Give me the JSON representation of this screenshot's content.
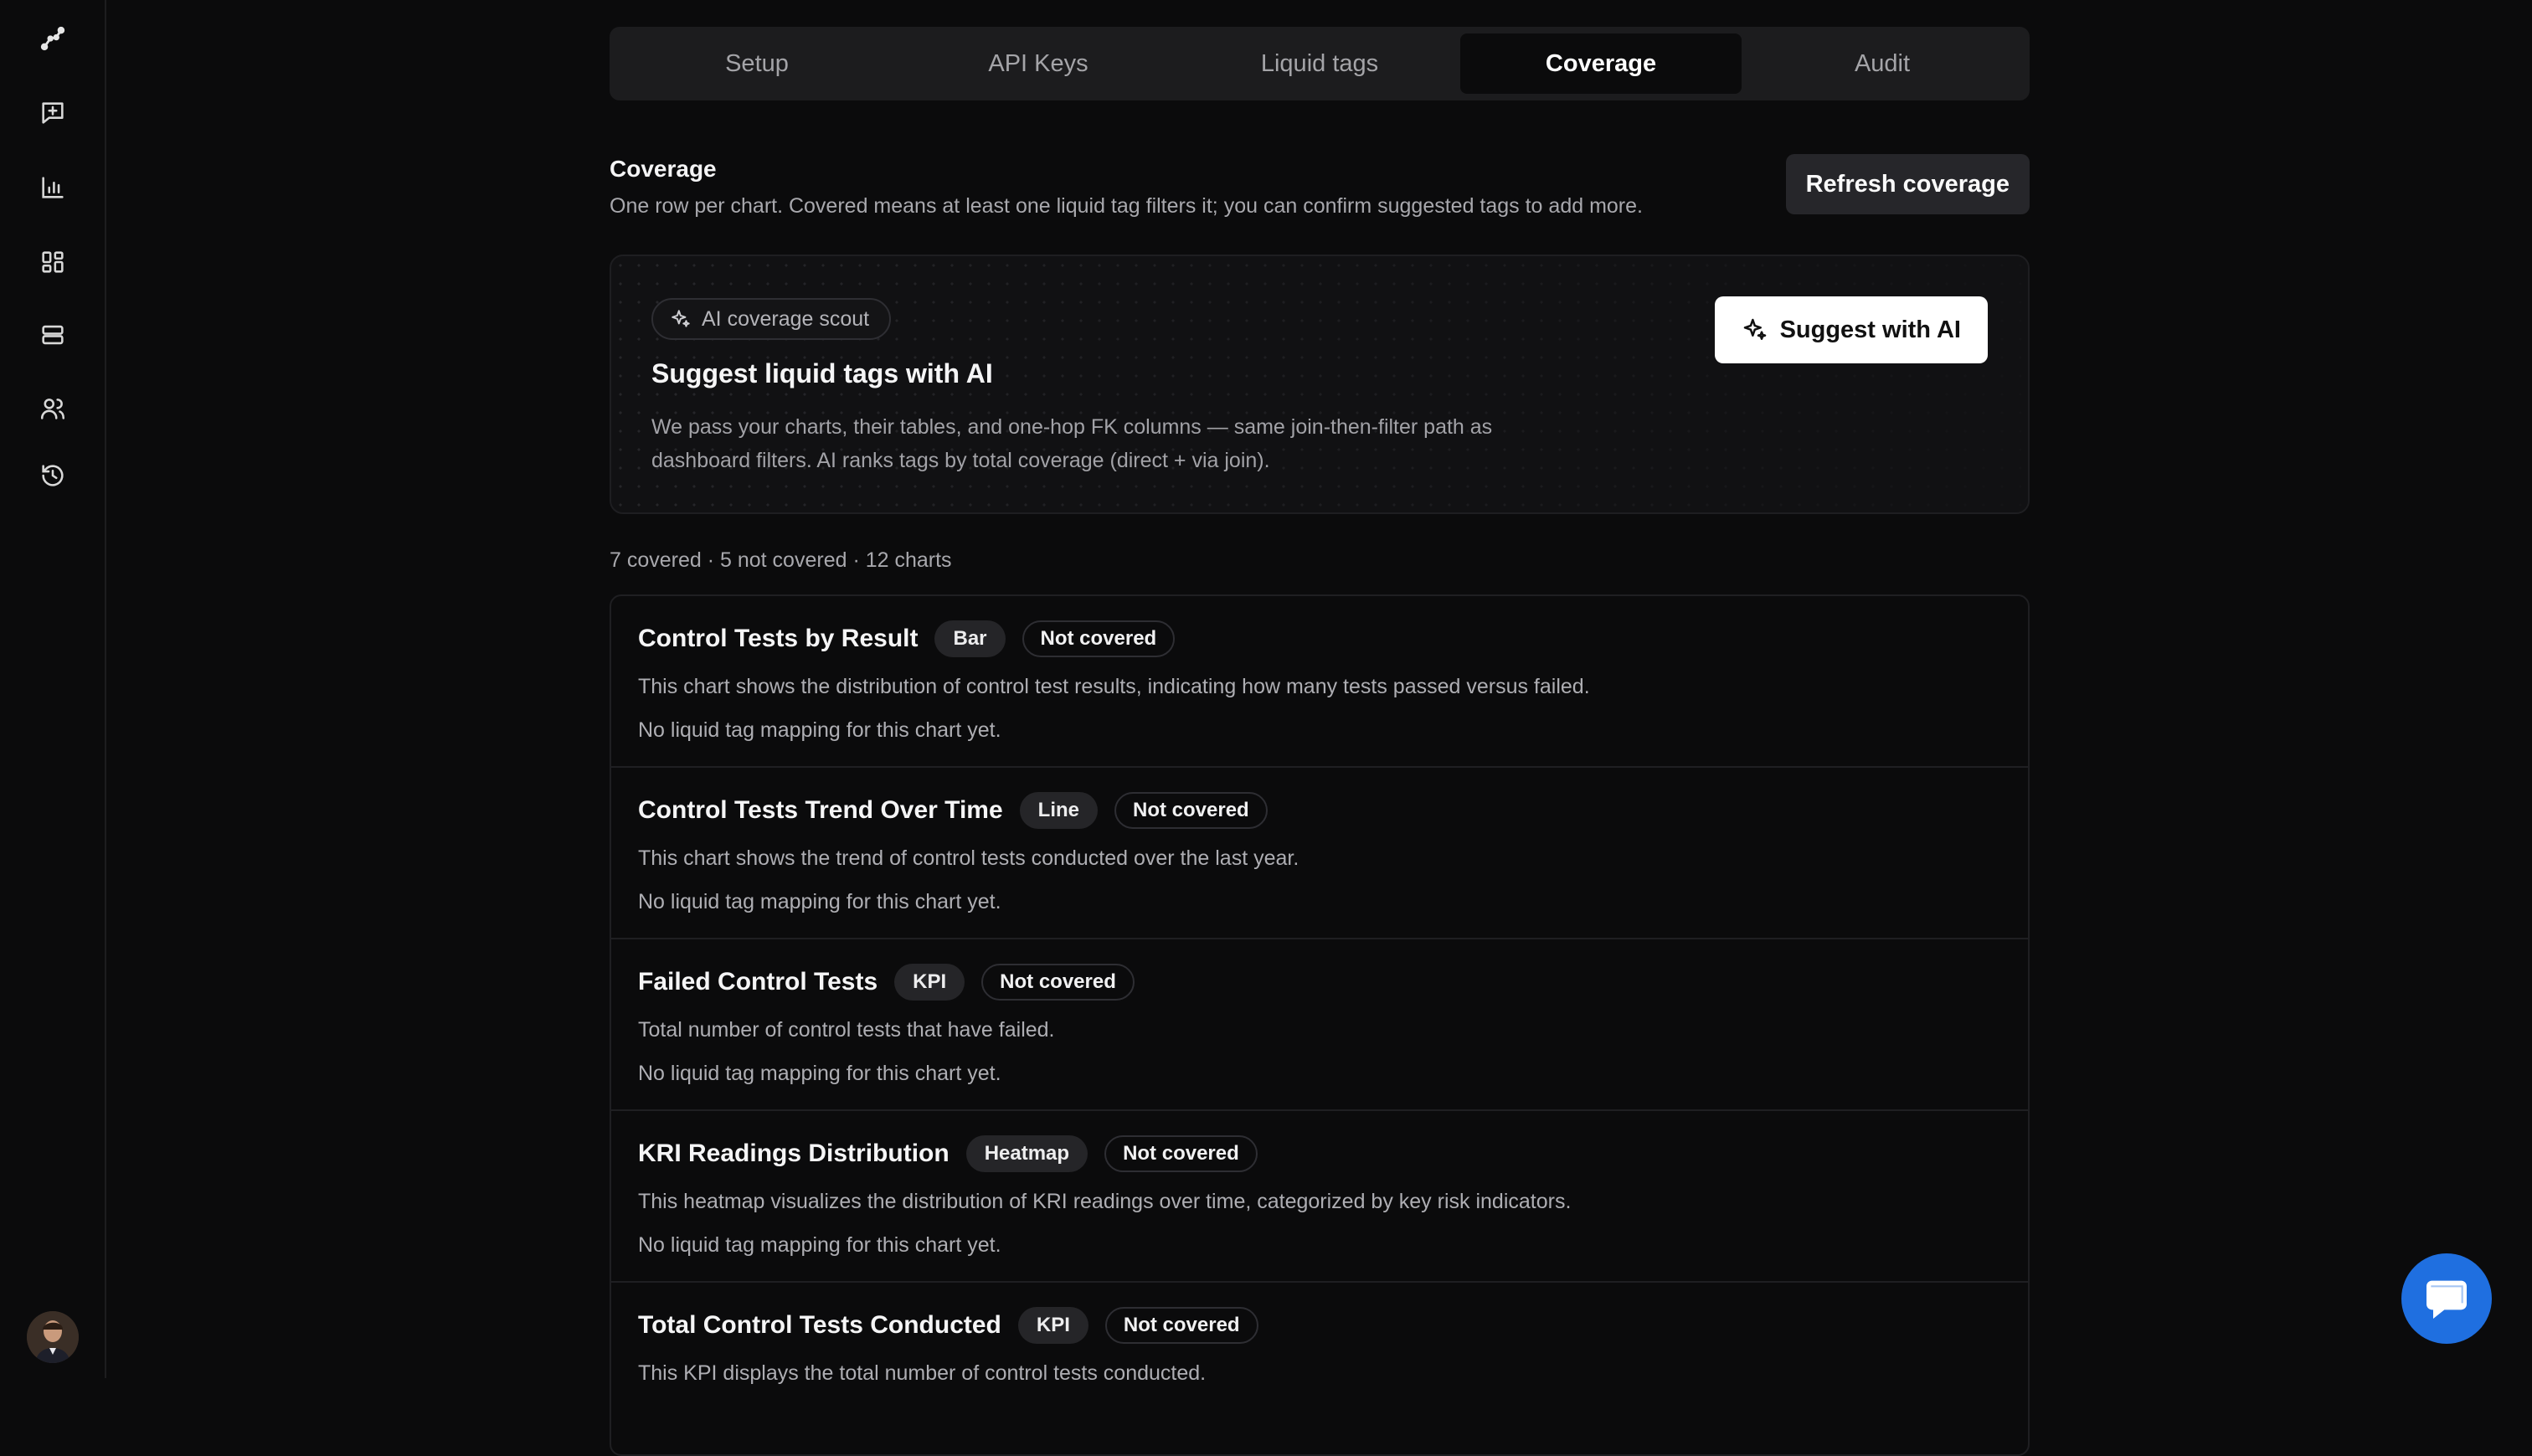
{
  "sidebar": {
    "icons": [
      "logo-graph-icon",
      "chat-plus-icon",
      "bar-chart-icon",
      "dashboard-grid-icon",
      "database-icon",
      "users-icon",
      "history-icon"
    ]
  },
  "tabs": [
    {
      "label": "Setup"
    },
    {
      "label": "API Keys"
    },
    {
      "label": "Liquid tags"
    },
    {
      "label": "Coverage"
    },
    {
      "label": "Audit"
    }
  ],
  "active_tab": "Coverage",
  "coverage": {
    "title": "Coverage",
    "description": "One row per chart. Covered means at least one liquid tag filters it; you can confirm suggested tags to add more.",
    "refresh_label": "Refresh coverage"
  },
  "ai_card": {
    "pill_label": "AI coverage scout",
    "title": "Suggest liquid tags with AI",
    "description": "We pass your charts, their tables, and one-hop FK columns — same join-then-filter path as dashboard filters. AI ranks tags by total coverage (direct + via join).",
    "button_label": "Suggest with AI"
  },
  "summary": "7 covered · 5 not covered · 12 charts",
  "charts": [
    {
      "title": "Control Tests by Result",
      "type": "Bar",
      "status": "Not covered",
      "description": "This chart shows the distribution of control test results, indicating how many tests passed versus failed.",
      "note": "No liquid tag mapping for this chart yet."
    },
    {
      "title": "Control Tests Trend Over Time",
      "type": "Line",
      "status": "Not covered",
      "description": "This chart shows the trend of control tests conducted over the last year.",
      "note": "No liquid tag mapping for this chart yet."
    },
    {
      "title": "Failed Control Tests",
      "type": "KPI",
      "status": "Not covered",
      "description": "Total number of control tests that have failed.",
      "note": "No liquid tag mapping for this chart yet."
    },
    {
      "title": "KRI Readings Distribution",
      "type": "Heatmap",
      "status": "Not covered",
      "description": "This heatmap visualizes the distribution of KRI readings over time, categorized by key risk indicators.",
      "note": "No liquid tag mapping for this chart yet."
    },
    {
      "title": "Total Control Tests Conducted",
      "type": "KPI",
      "status": "Not covered",
      "description": "This KPI displays the total number of control tests conducted.",
      "note": ""
    }
  ],
  "chat_fab": {
    "icon": "chat-bubble-icon",
    "color": "#1f6fe0"
  }
}
